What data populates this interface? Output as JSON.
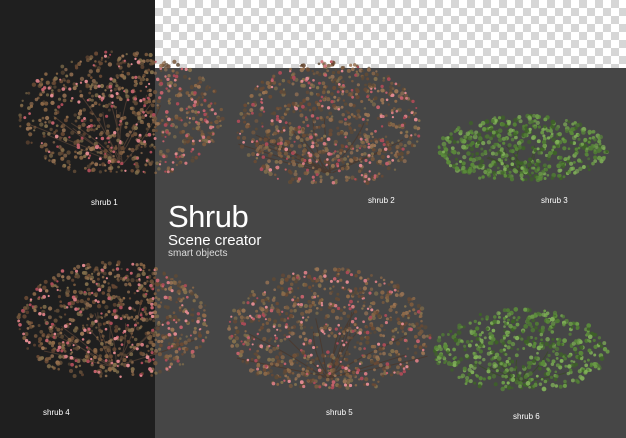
{
  "title": "Shrub",
  "subtitle": "Scene creator",
  "caption": "smart objects",
  "colors": {
    "left_panel": "#1f1f1f",
    "main_background": "#464646",
    "flowering_shrub_foliage": "#8a5a3e",
    "flowering_shrub_blossom": "#c0606a",
    "green_shrub_foliage": "#5e8a3e"
  },
  "shrubs": [
    {
      "label": "shrub 1",
      "kind": "flowering"
    },
    {
      "label": "shrub 2",
      "kind": "flowering"
    },
    {
      "label": "shrub 3",
      "kind": "green"
    },
    {
      "label": "shrub 4",
      "kind": "flowering"
    },
    {
      "label": "shrub 5",
      "kind": "flowering"
    },
    {
      "label": "shrub 6",
      "kind": "green"
    }
  ]
}
